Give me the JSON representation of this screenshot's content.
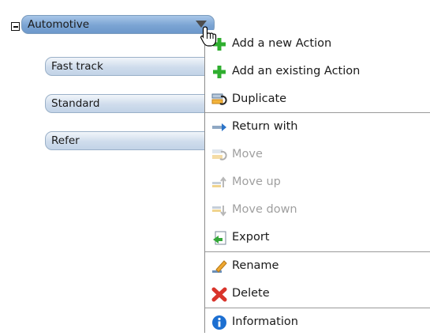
{
  "tree": {
    "root_label": "Automotive",
    "children": [
      "Fast track",
      "Standard",
      "Refer"
    ]
  },
  "context_menu": {
    "items": [
      {
        "label": "Add a new Action",
        "icon": "green-plus-icon",
        "enabled": true
      },
      {
        "label": "Add an existing Action",
        "icon": "green-plus-icon",
        "enabled": true
      },
      {
        "label": "Duplicate",
        "icon": "duplicate-icon",
        "enabled": true
      },
      {
        "label": "Return with",
        "icon": "return-arrow-icon",
        "enabled": true
      },
      {
        "label": "Move",
        "icon": "move-icon",
        "enabled": false
      },
      {
        "label": "Move up",
        "icon": "move-up-icon",
        "enabled": false
      },
      {
        "label": "Move down",
        "icon": "move-down-icon",
        "enabled": false
      },
      {
        "label": "Export",
        "icon": "export-icon",
        "enabled": true
      },
      {
        "label": "Rename",
        "icon": "rename-pencil-icon",
        "enabled": true
      },
      {
        "label": "Delete",
        "icon": "delete-x-icon",
        "enabled": true
      },
      {
        "label": "Information",
        "icon": "information-icon",
        "enabled": true
      }
    ]
  },
  "colors": {
    "root_node": "#7ba4d3",
    "child_node": "#cfdcec",
    "disabled_text": "#a0a0a0",
    "plus_green": "#2fae2f",
    "delete_red": "#d9342b",
    "info_blue": "#1c6fd1"
  }
}
